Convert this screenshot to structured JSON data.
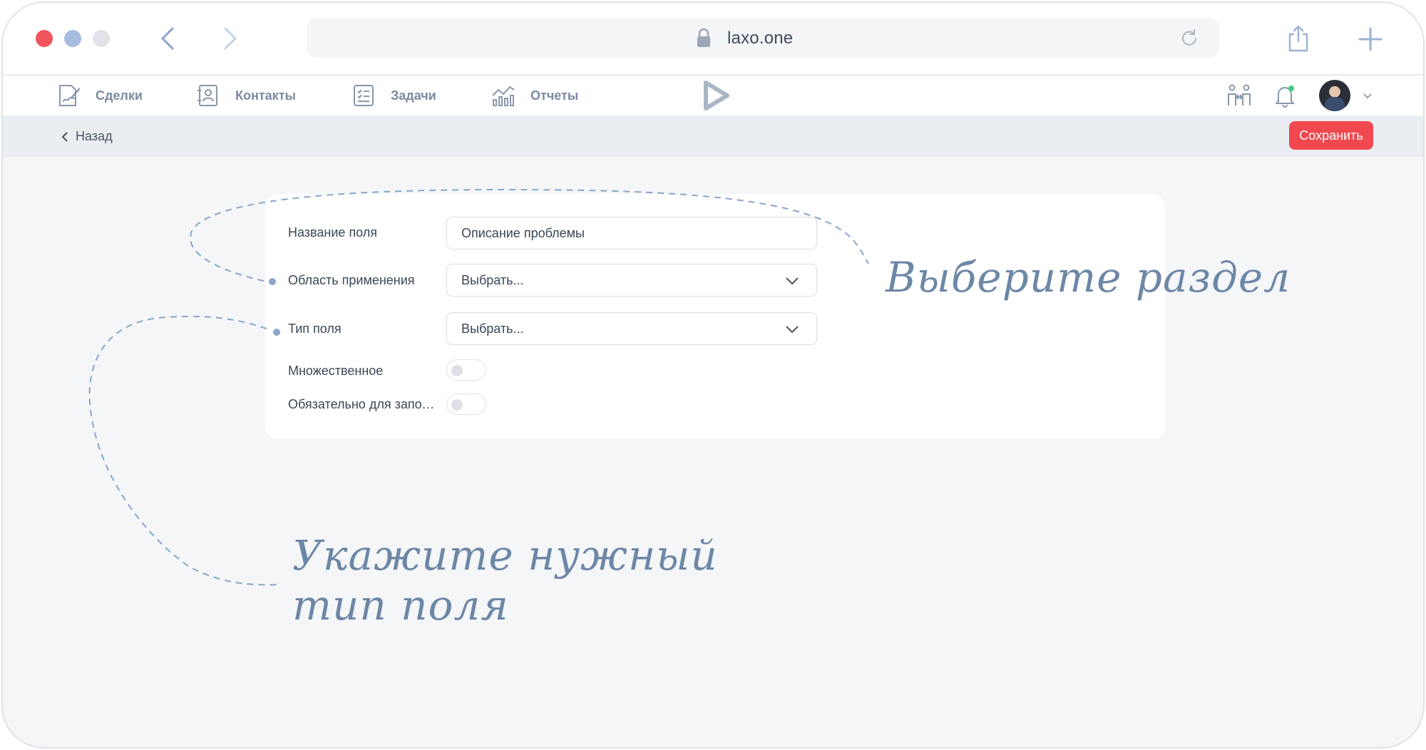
{
  "browser": {
    "url": "laxo.one"
  },
  "nav": {
    "items": [
      {
        "label": "Сделки",
        "icon": "deals-icon"
      },
      {
        "label": "Контакты",
        "icon": "contacts-icon"
      },
      {
        "label": "Задачи",
        "icon": "tasks-icon"
      },
      {
        "label": "Отчеты",
        "icon": "reports-icon"
      }
    ]
  },
  "subbar": {
    "back_label": "Назад",
    "save_label": "Сохранить"
  },
  "form": {
    "field_name": {
      "label": "Название поля",
      "value": "Описание проблемы"
    },
    "scope": {
      "label": "Область применения",
      "value": "Выбрать..."
    },
    "field_type": {
      "label": "Тип поля",
      "value": "Выбрать..."
    },
    "multiple": {
      "label": "Множественное",
      "enabled": false
    },
    "required": {
      "label": "Обязательно для запол...",
      "enabled": false
    }
  },
  "annotations": {
    "section_hint": "Выберите раздел",
    "type_hint_line1": "Укажите нужный",
    "type_hint_line2": "тип поля"
  },
  "colors": {
    "accent_red": "#f1484f",
    "nav_text": "#7c8aa0",
    "annotation": "#6d87a6",
    "background": "#f4f6f8"
  }
}
